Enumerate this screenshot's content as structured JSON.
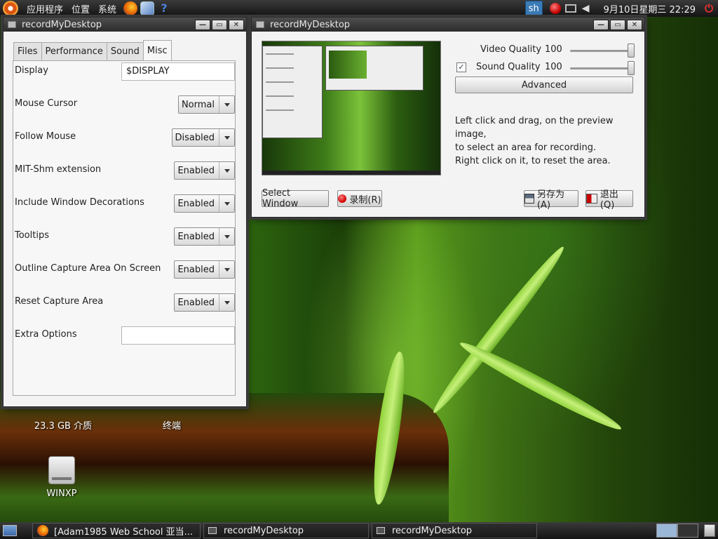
{
  "top_panel": {
    "menus": [
      "应用程序",
      "位置",
      "系统"
    ],
    "terminal_applet": "sh",
    "clock": "9月10日星期三 22:29"
  },
  "prefs_window": {
    "title": "recordMyDesktop",
    "tabs": [
      "Files",
      "Performance",
      "Sound",
      "Misc"
    ],
    "active_tab": "Misc",
    "settings": [
      {
        "label": "Display",
        "type": "text",
        "value": "$DISPLAY"
      },
      {
        "label": "Mouse Cursor",
        "type": "combo",
        "value": "Normal"
      },
      {
        "label": "Follow Mouse",
        "type": "combo",
        "value": "Disabled"
      },
      {
        "label": "MIT-Shm extension",
        "type": "combo",
        "value": "Enabled"
      },
      {
        "label": "Include Window Decorations",
        "type": "combo",
        "value": "Enabled"
      },
      {
        "label": "Tooltips",
        "type": "combo",
        "value": "Enabled"
      },
      {
        "label": "Outline Capture Area On Screen",
        "type": "combo",
        "value": "Enabled"
      },
      {
        "label": "Reset Capture Area",
        "type": "combo",
        "value": "Enabled"
      },
      {
        "label": "Extra Options",
        "type": "text",
        "value": ""
      }
    ]
  },
  "main_window": {
    "title": "recordMyDesktop",
    "video_quality": {
      "label": "Video Quality",
      "value": "100",
      "level": 1.0
    },
    "sound_quality": {
      "label": "Sound Quality",
      "value": "100",
      "level": 1.0,
      "checked": true
    },
    "advanced_label": "Advanced",
    "hint_lines": [
      "Left click and drag, on the preview image,",
      "to select an area for recording.",
      "Right click on it, to reset the area."
    ],
    "select_window_label": "Select Window",
    "record_label": "录制(R)",
    "save_as_label": "另存为(A)",
    "quit_label": "退出(Q)"
  },
  "desktop": {
    "icons": [
      {
        "label": "23.3 GB 介质"
      },
      {
        "label": "终端"
      },
      {
        "label": "WINXP"
      }
    ]
  },
  "taskbar": {
    "tasks": [
      {
        "label": "[Adam1985 Web School 亚当..."
      },
      {
        "label": "recordMyDesktop"
      },
      {
        "label": "recordMyDesktop"
      }
    ]
  },
  "colors": {
    "panel_bg": "#1e1e1e",
    "window_bg": "#f3f3f3",
    "titlebar_bg": "#3a3a3a",
    "accent_red": "#d00000"
  }
}
